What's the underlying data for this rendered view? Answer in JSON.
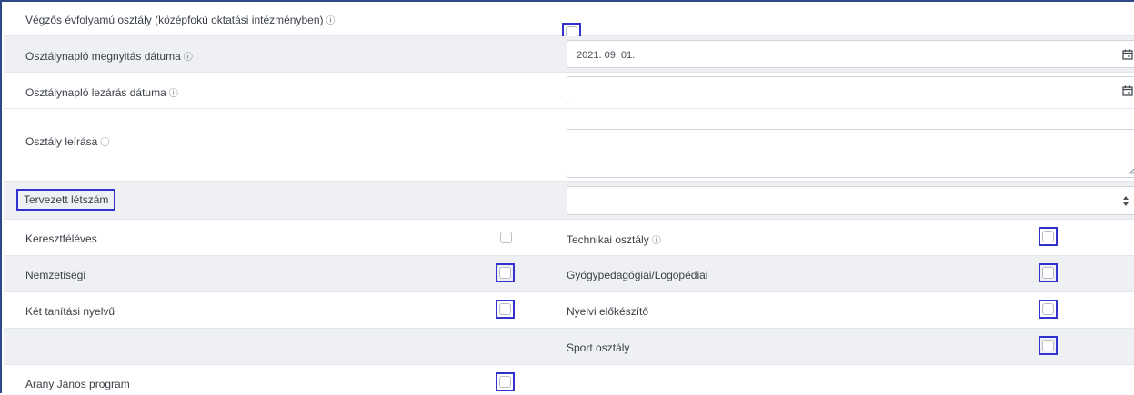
{
  "rows": {
    "vegzos_label": "Végzős évfolyamú osztály (középfokú oktatási intézményben)",
    "megnyitas_label": "Osztálynapló megnyitás dátuma",
    "megnyitas_value": "2021. 09. 01.",
    "lezaras_label": "Osztálynapló lezárás dátuma",
    "lezaras_value": "",
    "leiras_label": "Osztály leírása",
    "leiras_value": "",
    "tervezett_label": "Tervezett létszám",
    "tervezett_value": "",
    "kereszt_label": "Keresztféléves",
    "technikai_label": "Technikai osztály",
    "nemzetisegi_label": "Nemzetiségi",
    "gyogy_label": "Gyógypedagógiai/Logopédiai",
    "ket_label": "Két tanítási nyelvű",
    "nyelvi_label": "Nyelvi előkészítő",
    "sport_label": "Sport osztály",
    "arany_label": "Arany János program"
  },
  "icons": {
    "info": "ⓘ",
    "calendar": "calendar-icon",
    "spinner": "spinner-icon"
  },
  "colors": {
    "highlight": "#3333cc",
    "frame": "#2d4a86",
    "shade": "#eef0f3"
  }
}
